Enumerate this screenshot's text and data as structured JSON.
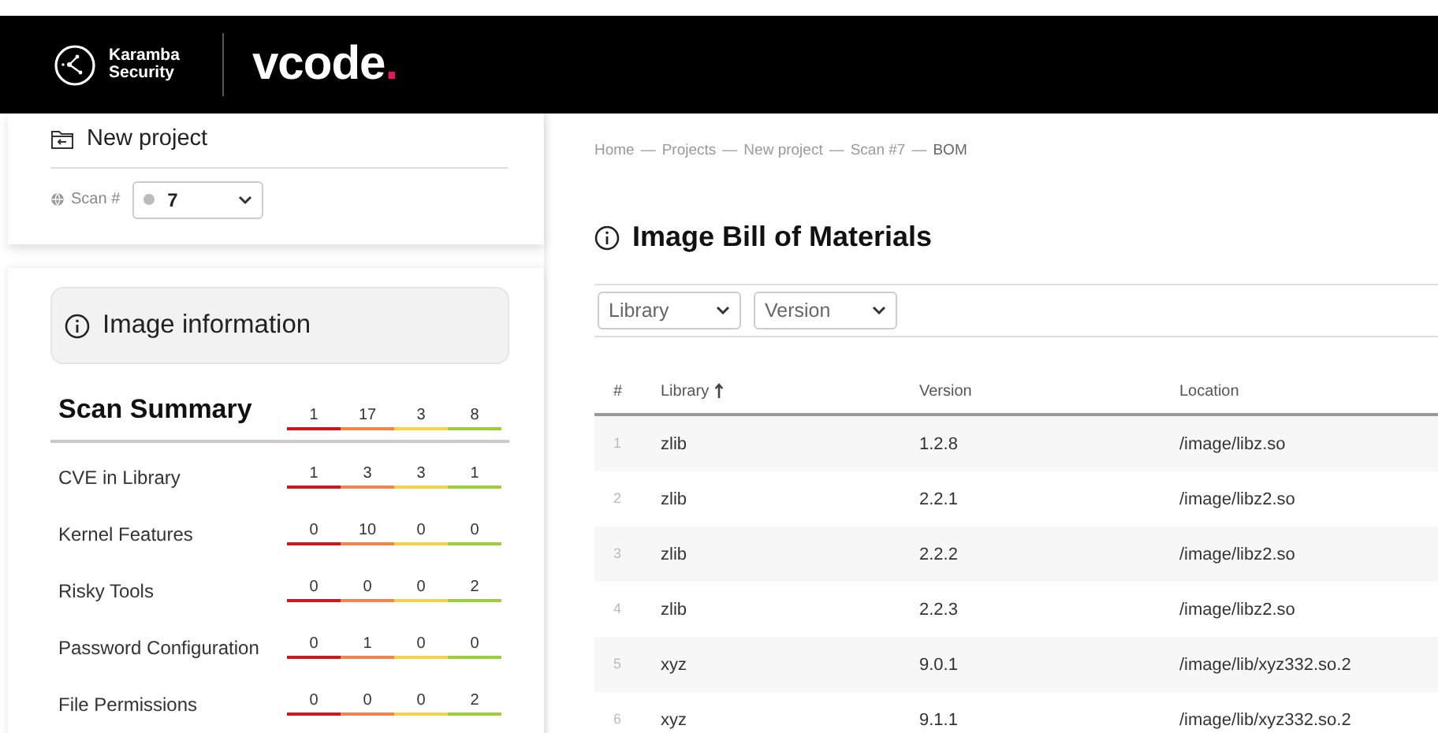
{
  "header": {
    "company": "Karamba Security",
    "brand": {
      "name": "vcode",
      "mark": "."
    }
  },
  "project": {
    "title": "New project",
    "scan_label": "Scan #",
    "scan_value": "7"
  },
  "image_info": {
    "title": "Image information"
  },
  "scan_summary": {
    "title": "Scan Summary",
    "severities": [
      {
        "color": "#d0161f"
      },
      {
        "color": "#f2834a"
      },
      {
        "color": "#f5d24b"
      },
      {
        "color": "#9ccf3c"
      }
    ],
    "totals": [
      "1",
      "17",
      "3",
      "8"
    ],
    "rows": [
      {
        "label": "CVE in Library",
        "counts": [
          "1",
          "3",
          "3",
          "1"
        ]
      },
      {
        "label": "Kernel Features",
        "counts": [
          "0",
          "10",
          "0",
          "0"
        ]
      },
      {
        "label": "Risky Tools",
        "counts": [
          "0",
          "0",
          "0",
          "2"
        ]
      },
      {
        "label": "Password Configuration",
        "counts": [
          "0",
          "1",
          "0",
          "0"
        ]
      },
      {
        "label": "File Permissions",
        "counts": [
          "0",
          "0",
          "0",
          "2"
        ]
      }
    ]
  },
  "breadcrumb": [
    "Home",
    "Projects",
    "New project",
    "Scan #7",
    "BOM"
  ],
  "breadcrumb_separator": "—",
  "bom": {
    "title": "Image Bill of Materials",
    "filters": [
      "Library",
      "Version"
    ],
    "table": {
      "columns": [
        {
          "label": "#",
          "sorted": false
        },
        {
          "label": "Library",
          "sorted": true
        },
        {
          "label": "Version",
          "sorted": false
        },
        {
          "label": "Location",
          "sorted": false
        }
      ],
      "rows": [
        [
          "1",
          "zlib",
          "1.2.8",
          "/image/libz.so"
        ],
        [
          "2",
          "zlib",
          "2.2.1",
          "/image/libz2.so"
        ],
        [
          "3",
          "zlib",
          "2.2.2",
          "/image/libz2.so"
        ],
        [
          "4",
          "zlib",
          "2.2.3",
          "/image/libz2.so"
        ],
        [
          "5",
          "xyz",
          "9.0.1",
          "/image/lib/xyz332.so.2"
        ],
        [
          "6",
          "xyz",
          "9.1.1",
          "/image/lib/xyz332.so.2"
        ]
      ]
    }
  }
}
